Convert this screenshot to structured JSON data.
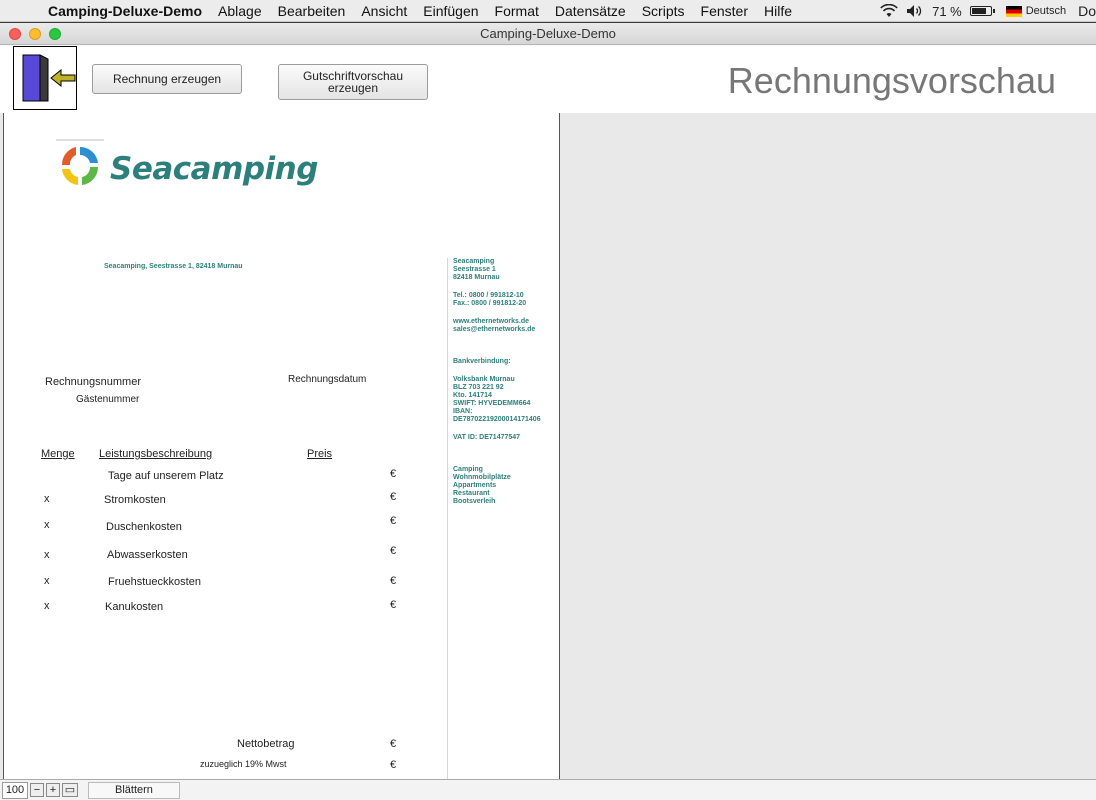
{
  "menubar": {
    "app": "Camping-Deluxe-Demo",
    "items": [
      "Ablage",
      "Bearbeiten",
      "Ansicht",
      "Einfügen",
      "Format",
      "Datensätze",
      "Scripts",
      "Fenster",
      "Hilfe"
    ],
    "battery": "71 %",
    "language": "Deutsch",
    "user": "Do"
  },
  "window": {
    "title": "Camping-Deluxe-Demo"
  },
  "toolbar": {
    "invoice_label": "Rechnung erzeugen",
    "credit_label": "Gutschriftvorschau\nerzeugen",
    "page_title": "Rechnungsvorschau"
  },
  "invoice": {
    "brand": "Seacamping",
    "sender_line": "Seacamping, Seestrasse 1, 82418 Murnau",
    "contact": {
      "address": "Seacamping\nSeestrasse 1\n82418 Murnau",
      "phone": "Tel.: 0800 / 991812-10\nFax.: 0800 / 991812-20",
      "web": "www.ethernetworks.de\nsales@ethernetworks.de",
      "bank_label": "Bankverbindung:",
      "bank": "Volksbank Murnau\nBLZ  703 221 92\nKto.  141714\nSWIFT: HYVEDEMM664\nIBAN:\nDE78702219200014171406",
      "vat": "VAT ID: DE71477547",
      "services": "Camping\nWohnmobilplätze\nAppartments\nRestaurant\nBootsverleih"
    },
    "labels": {
      "invoice_number": "Rechnungsnummer",
      "invoice_date": "Rechnungsdatum",
      "guest_number": "Gästenummer",
      "col_qty": "Menge",
      "col_desc": "Leistungsbeschreibung",
      "col_price": "Preis",
      "net": "Nettobetrag",
      "vat": "zuzueglich 19% Mwst",
      "currency": "€"
    },
    "lines": [
      {
        "qty": "",
        "desc": "Tage auf unserem Platz"
      },
      {
        "qty": "x",
        "desc": "Stromkosten"
      },
      {
        "qty": "x",
        "desc": "Duschenkosten"
      },
      {
        "qty": "x",
        "desc": "Abwasserkosten"
      },
      {
        "qty": "x",
        "desc": "Fruehstueckkosten"
      },
      {
        "qty": "x",
        "desc": "Kanukosten"
      }
    ]
  },
  "statusbar": {
    "zoom": "100",
    "mode": "Blättern"
  },
  "colors": {
    "accent": "#2c7f7a",
    "title_gray": "#777777"
  }
}
